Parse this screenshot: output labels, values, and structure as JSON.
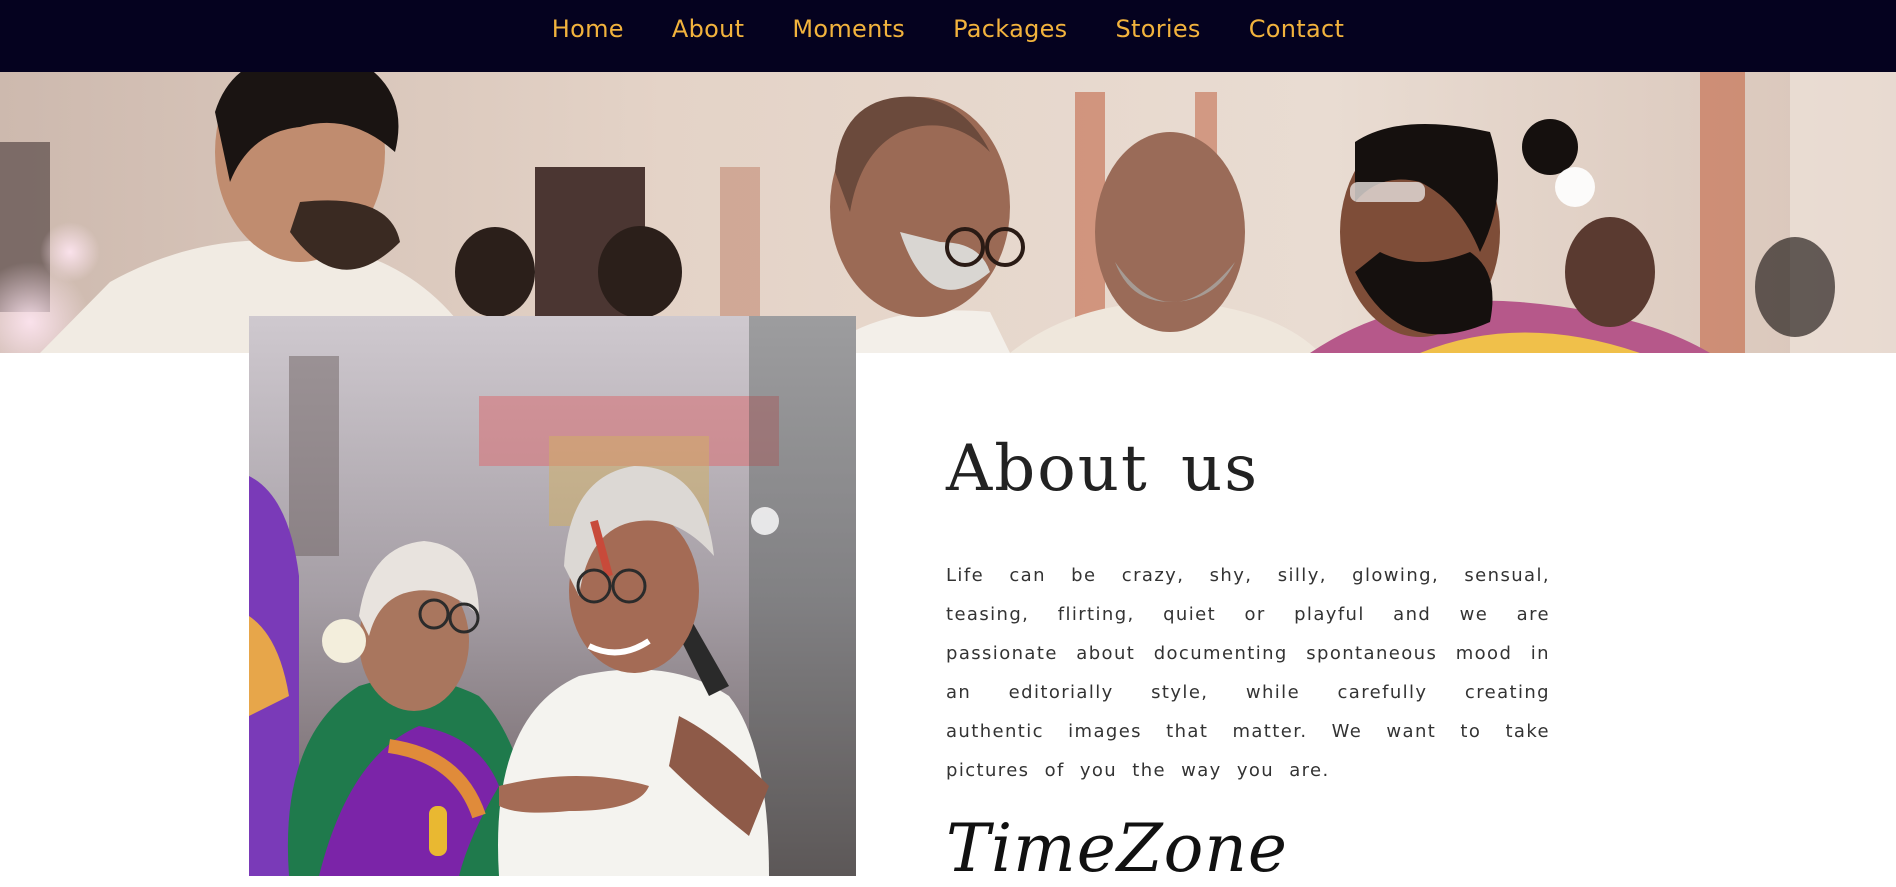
{
  "nav": {
    "items": [
      "Home",
      "About",
      "Moments",
      "Packages",
      "Stories",
      "Contact"
    ]
  },
  "about": {
    "title": "About us",
    "text": "Life can be crazy, shy, silly, glowing, sensual, teasing, flirting, quiet or playful and we are passionate about documenting spontaneous mood in an editorially style, while carefully creating authentic images that matter. We want to take pictures of you the way you are."
  },
  "brand": {
    "name": "TimeZone"
  },
  "colors": {
    "nav_bg": "#05021f",
    "nav_text": "#f2b33d",
    "title": "#222222",
    "body_text": "#333333"
  }
}
